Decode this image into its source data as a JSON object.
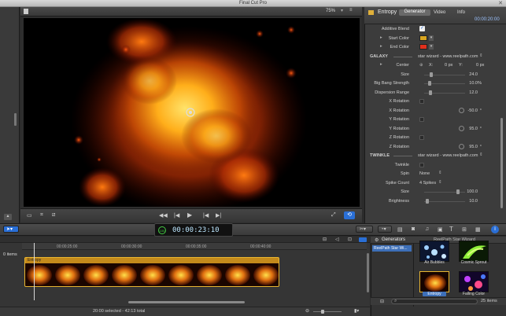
{
  "window": {
    "title": "Final Cut Pro"
  },
  "viewer": {
    "zoom": "75%",
    "timecode": "23:10",
    "timecode_full": "00:00:23:10",
    "tc_prefix": "100"
  },
  "inspector": {
    "title": "Entropy",
    "tabs": [
      "Generator",
      "Video",
      "Info"
    ],
    "active_tab": "Generator",
    "duration": "00:00:20:00",
    "rows": [
      {
        "label": "Additive Blend",
        "kind": "check"
      },
      {
        "label": "Start Color",
        "kind": "color",
        "color": "#d9a520"
      },
      {
        "label": "End Color",
        "kind": "color",
        "color": "#e0301c"
      },
      {
        "label": "GALAXY",
        "kind": "section",
        "value": "star wizard - www.reelpath.com"
      },
      {
        "label": "Center",
        "kind": "xy",
        "x_label": "X:",
        "x": "0 px",
        "y_label": "Y:",
        "y": "0 px"
      },
      {
        "label": "Size",
        "kind": "slider",
        "value": "24.0",
        "pos": 0.15
      },
      {
        "label": "Big Bang  Strength",
        "kind": "slider",
        "value": "10.0",
        "unit": "%",
        "pos": 0.1
      },
      {
        "label": "Dispersion Range",
        "kind": "slider",
        "value": "12.0",
        "pos": 0.12
      },
      {
        "label": "X Rotation",
        "kind": "check-off"
      },
      {
        "label": "X Rotation",
        "kind": "dial",
        "value": "-50.0",
        "unit": "°"
      },
      {
        "label": "Y Rotation",
        "kind": "check-off"
      },
      {
        "label": "Y Rotation",
        "kind": "dial",
        "value": "95.0",
        "unit": "°"
      },
      {
        "label": "Z Rotation",
        "kind": "check-off"
      },
      {
        "label": "Z Rotation",
        "kind": "dial",
        "value": "95.0",
        "unit": "°"
      },
      {
        "label": "TWINKLE",
        "kind": "section",
        "value": "star wizard - www.reelpath.com"
      },
      {
        "label": "Twinkle",
        "kind": "check-off"
      },
      {
        "label": "Spin",
        "kind": "select",
        "value": "None"
      },
      {
        "label": "Spike Count",
        "kind": "select",
        "value": "4 Spikes"
      },
      {
        "label": "Size",
        "kind": "slider",
        "value": "100.0",
        "pos": 0.85
      },
      {
        "label": "Brightness",
        "kind": "slider",
        "value": "10.0",
        "pos": 0.05
      }
    ]
  },
  "timeline": {
    "items_label": "0 items",
    "clip_title": "Entropy",
    "ruler": [
      "00:00:25:00",
      "00:00:30:00",
      "00:00:35:00",
      "00:00:40:00"
    ],
    "status": "20:00 selected - 42:13 total"
  },
  "generators": {
    "title": "Generators",
    "breadcrumb": "ReelPath Star Wizard",
    "category": "ReelPath Star Wi...",
    "items": [
      {
        "label": "Air Bubbles"
      },
      {
        "label": "Cosmic Sprout"
      },
      {
        "label": "Entropy"
      },
      {
        "label": "Falling Color"
      }
    ],
    "count": "25 items"
  }
}
